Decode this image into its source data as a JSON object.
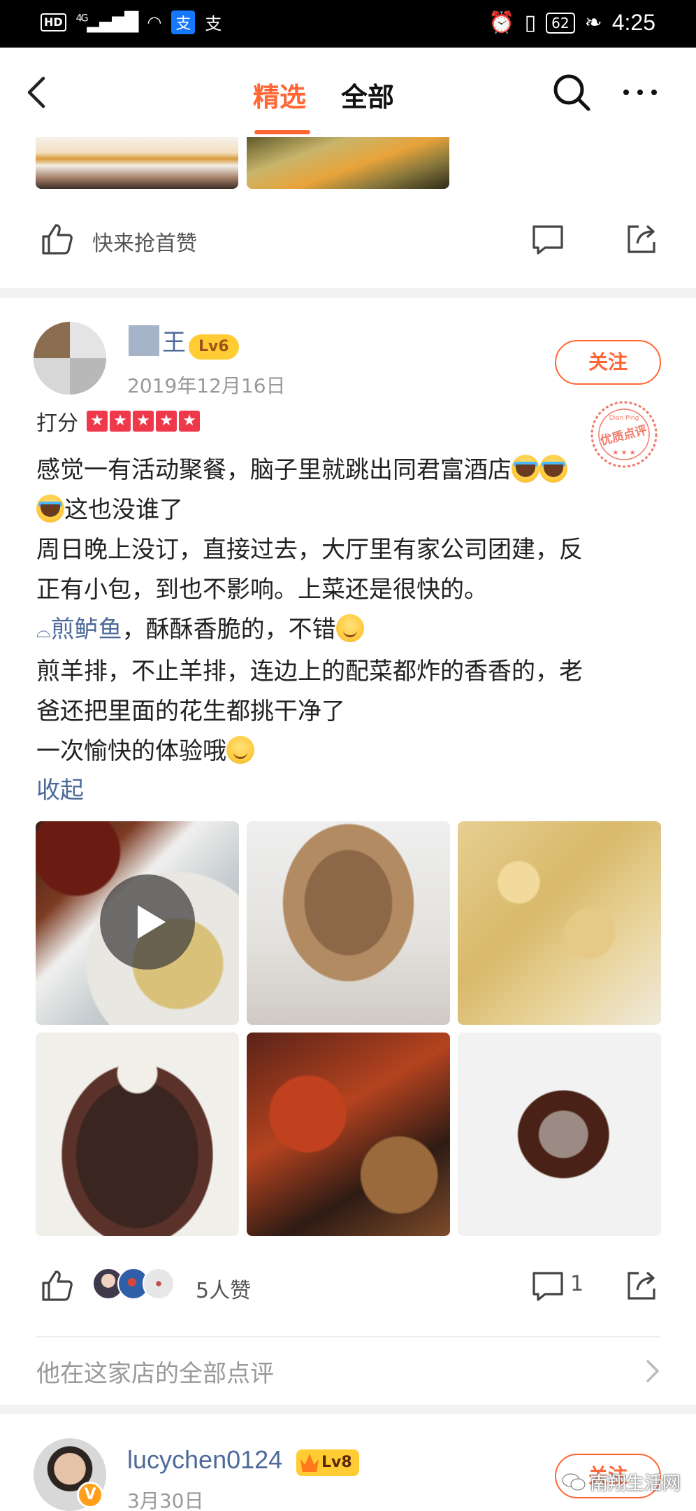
{
  "status_bar": {
    "hd": "HD",
    "network": "4G",
    "alipay_1": "支",
    "alipay_2": "支",
    "battery": "62",
    "time": "4:25"
  },
  "nav": {
    "tabs": [
      {
        "label": "精选",
        "active": true
      },
      {
        "label": "全部",
        "active": false
      }
    ],
    "accent": "#ff6633"
  },
  "prev_card": {
    "like_prompt": "快来抢首赞"
  },
  "review": {
    "username_visible": "王",
    "level": "Lv6",
    "date": "2019年12月16日",
    "follow_label": "关注",
    "rating_label": "打分",
    "stars": 5,
    "quality_stamp": "优质点评",
    "quality_stamp_en": "Dian Ping",
    "lines": {
      "l1": "感觉一有活动聚餐，脑子里就跳出同君富酒店",
      "l2": "这也没谁了",
      "l3": "周日晚上没订，直接过去，大厅里有家公司团建，反",
      "l4": "正有小包，到也不影响。上菜还是很快的。",
      "l5_dish": "煎鲈鱼",
      "l5_rest": "，酥酥香脆的，不错",
      "l6": "煎羊排，不止羊排，连边上的配菜都炸的香香的，老",
      "l7": "爸还把里面的花生都挑干净了",
      "l8": "一次愉快的体验哦"
    },
    "collapse_label": "收起",
    "photo_count": 6,
    "like_count_label": "5人赞",
    "comment_count": "1",
    "all_reviews_label": "他在这家店的全部点评"
  },
  "next_review": {
    "username": "lucychen0124",
    "level": "Lv8",
    "vip": "V",
    "date": "3月30日",
    "follow_label": "关注"
  },
  "watermark": "南翔生活网"
}
